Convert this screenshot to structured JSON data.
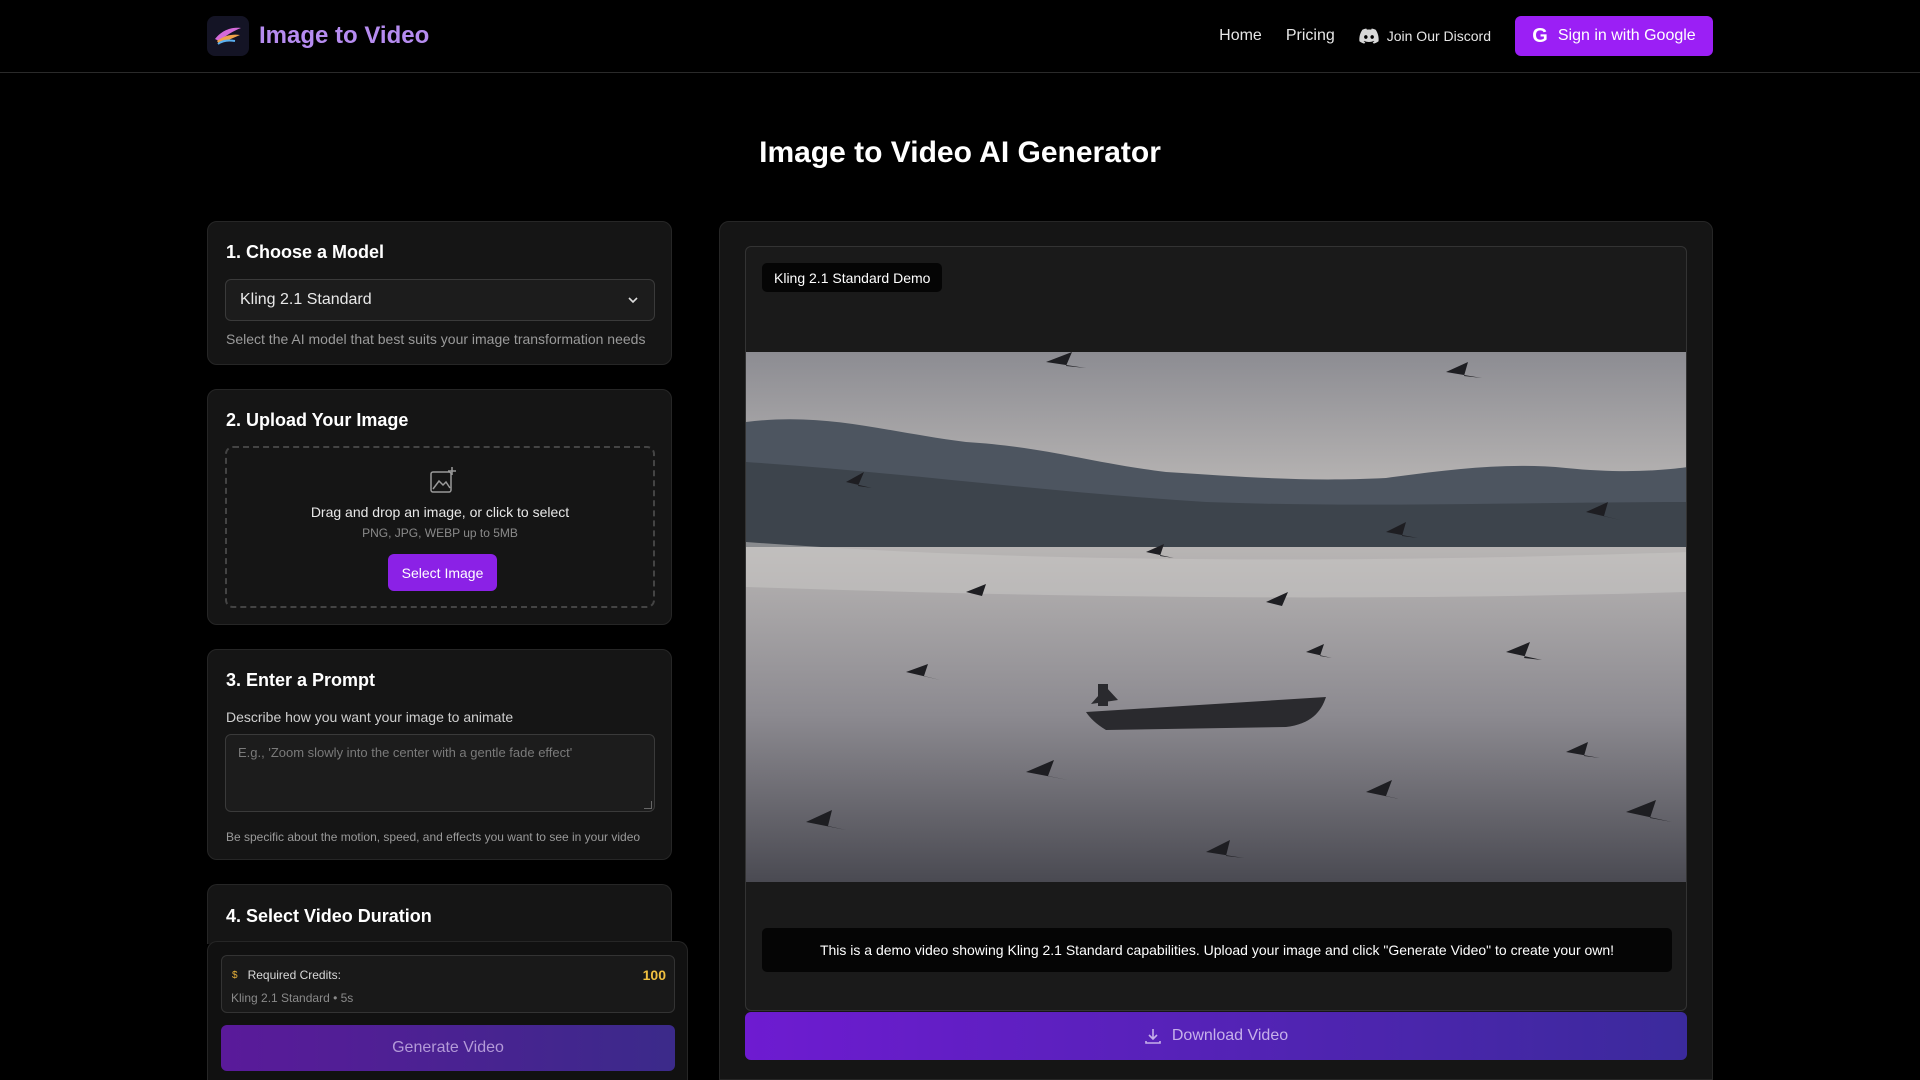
{
  "header": {
    "brand": "Image to Video",
    "nav": {
      "home": "Home",
      "pricing": "Pricing",
      "discord": "Join Our Discord",
      "sign_in": "Sign in with Google"
    }
  },
  "page": {
    "title": "Image to Video AI Generator"
  },
  "steps": {
    "model": {
      "title": "1. Choose a Model",
      "selected": "Kling 2.1 Standard",
      "hint": "Select the AI model that best suits your image transformation needs"
    },
    "upload": {
      "title": "2. Upload Your Image",
      "drop_text": "Drag and drop an image, or click to select",
      "formats": "PNG, JPG, WEBP up to 5MB",
      "button": "Select Image"
    },
    "prompt": {
      "title": "3. Enter a Prompt",
      "label": "Describe how you want your image to animate",
      "placeholder": "E.g., 'Zoom slowly into the center with a gentle fade effect'",
      "hint": "Be specific about the motion, speed, and effects you want to see in your video"
    },
    "duration": {
      "title": "4. Select Video Duration"
    }
  },
  "credits": {
    "label": "Required Credits:",
    "value": "100",
    "detail": "Kling 2.1 Standard • 5s",
    "generate": "Generate Video"
  },
  "preview": {
    "badge": "Kling 2.1 Standard Demo",
    "caption": "This is a demo video showing Kling 2.1 Standard capabilities. Upload your image and click \"Generate Video\" to create your own!",
    "download": "Download Video"
  },
  "colors": {
    "accent": "#9b1ff5",
    "credits_value": "#f0c040",
    "brand_text": "#b68cf0"
  },
  "icons": {
    "logo": "feather-logo-icon",
    "discord": "discord-icon",
    "google": "google-icon",
    "dropdown": "chevron-down-icon",
    "upload": "image-add-icon",
    "coin": "coin-icon",
    "download": "download-icon"
  }
}
